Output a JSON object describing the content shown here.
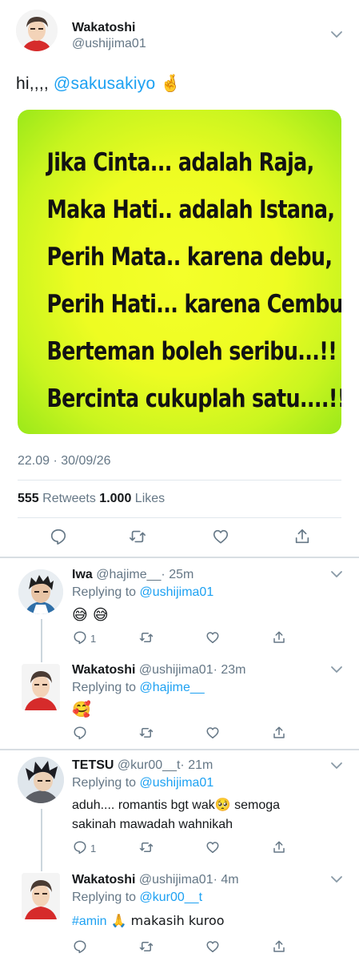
{
  "main_tweet": {
    "display_name": "Wakatoshi",
    "handle": "@ushijima01",
    "text_prefix": "hi,,,, ",
    "mention": "@sakusakiyo",
    "emoji": "🤞",
    "image_lines": [
      "Jika Cinta... adalah Raja,",
      "Maka Hati.. adalah Istana,",
      "Perih Mata.. karena debu,",
      "Perih Hati... karena Cemburu,",
      "Berteman boleh seribu...!!",
      "Bercinta cukuplah satu....!!"
    ],
    "timestamp": "22.09 · 30/09/26",
    "retweets_count": "555",
    "retweets_label": " Retweets ",
    "likes_count": "1.000",
    "likes_label": " Likes"
  },
  "replies": [
    {
      "display_name": "Iwa",
      "handle": "@hajime__",
      "time": "· 25m",
      "replying_label": "Replying to ",
      "replying_to": "@ushijima01",
      "text": "😅 😅",
      "reply_count": "1"
    },
    {
      "display_name": "Wakatoshi",
      "handle": "@ushijima01",
      "time": "· 23m",
      "replying_label": "Replying to ",
      "replying_to": "@hajime__",
      "text": "🥰",
      "reply_count": ""
    },
    {
      "display_name": "TETSU",
      "handle": "@kur00__t",
      "time": "· 21m",
      "replying_label": "Replying to ",
      "replying_to": "@ushijima01",
      "text_line1": "aduh.... romantis bgt wak🥺 semoga",
      "text_line2": "sakinah mawadah wahnikah",
      "reply_count": "1"
    },
    {
      "display_name": "Wakatoshi",
      "handle": "@ushijima01",
      "time": "· 4m",
      "replying_label": "Replying to ",
      "replying_to": "@kur00__t",
      "hashtag": "#amin",
      "text": " 🙏 makasih kuroo",
      "reply_count": ""
    }
  ],
  "icons": {
    "reply": "reply-icon",
    "retweet": "retweet-icon",
    "like": "heart-icon",
    "share": "share-icon",
    "more": "chevron-down-icon"
  },
  "colors": {
    "link": "#1da1f2",
    "muted": "#657786",
    "text": "#14171a",
    "meme_background": "#eefc22"
  }
}
